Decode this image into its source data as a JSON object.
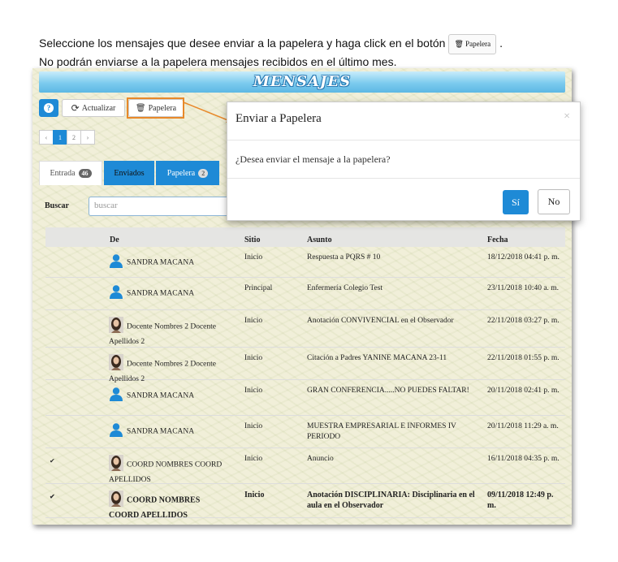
{
  "instructions": {
    "line1_before": "Seleccione los mensajes que desee enviar a la papelera y haga click en el botón",
    "line1_button": "Papelera",
    "line1_after": ".",
    "line2": "No podrán enviarse a la papelera mensajes recibidos en el último mes."
  },
  "banner_title": "MENSAJES",
  "toolbar": {
    "help_label": "?",
    "refresh_label": "Actualizar",
    "trash_label": "Papelera"
  },
  "pager": {
    "prev": "‹",
    "pages": [
      "1",
      "2"
    ],
    "next": "›",
    "current": "1"
  },
  "tabs": [
    {
      "label": "Entrada",
      "count": "46"
    },
    {
      "label": "Enviados",
      "count": ""
    },
    {
      "label": "Papelera",
      "count": "2"
    }
  ],
  "search": {
    "label": "Buscar",
    "placeholder": "buscar"
  },
  "table": {
    "headers": {
      "from": "De",
      "site": "Sitio",
      "subject": "Asunto",
      "date": "Fecha"
    },
    "rows": [
      {
        "from": "SANDRA MACANA",
        "site": "Inicio",
        "subject": "Respuesta a PQRS # 10",
        "date": "18/12/2018  04:41 p. m.",
        "avatar": "user-icon",
        "checked": false,
        "bold": false
      },
      {
        "from": "SANDRA MACANA",
        "site": "Principal",
        "subject": "Enfermería Colegio Test",
        "date": "23/11/2018  10:40 a. m.",
        "avatar": "user-icon",
        "checked": false,
        "bold": false
      },
      {
        "from": "Docente Nombres 2 Docente Apellidos 2",
        "site": "Inicio",
        "subject": "Anotación CONVIVENCIAL en el Observador",
        "date": "22/11/2018  03:27 p. m.",
        "avatar": "photo",
        "checked": false,
        "bold": false
      },
      {
        "from": "Docente Nombres 2 Docente Apellidos 2",
        "site": "Inicio",
        "subject": "Citación a Padres YANINE MACANA 23-11",
        "date": "22/11/2018  01:55 p. m.",
        "avatar": "photo",
        "checked": false,
        "bold": false
      },
      {
        "from": "SANDRA MACANA",
        "site": "Inicio",
        "subject": "GRAN CONFERENCIA.....NO PUEDES FALTAR!",
        "date": "20/11/2018  02:41 p. m.",
        "avatar": "user-icon",
        "checked": false,
        "bold": false
      },
      {
        "from": "SANDRA MACANA",
        "site": "Inicio",
        "subject": "MUESTRA EMPRESARIAL E INFORMES IV PERIODO",
        "date": "20/11/2018  11:29 a. m.",
        "avatar": "user-icon",
        "checked": false,
        "bold": false
      },
      {
        "from": "COORD NOMBRES COORD APELLIDOS",
        "site": "Inicio",
        "subject": "Anuncio",
        "date": "16/11/2018  04:35 p. m.",
        "avatar": "photo",
        "checked": true,
        "bold": false
      },
      {
        "from": "COORD NOMBRES COORD APELLIDOS",
        "site": "Inicio",
        "subject": "Anotación DISCIPLINARIA: Disciplinaria en el aula en el Observador",
        "date": "09/11/2018  12:49 p. m.",
        "avatar": "photo",
        "checked": true,
        "bold": true
      }
    ]
  },
  "modal": {
    "title": "Enviar a Papelera",
    "close": "×",
    "body": "¿Desea enviar el mensaje a la papelera?",
    "yes": "Sí",
    "no": "No"
  },
  "colors": {
    "accent": "#1e8ad6",
    "callout": "#e8892a",
    "banner": "#7ccbee"
  }
}
